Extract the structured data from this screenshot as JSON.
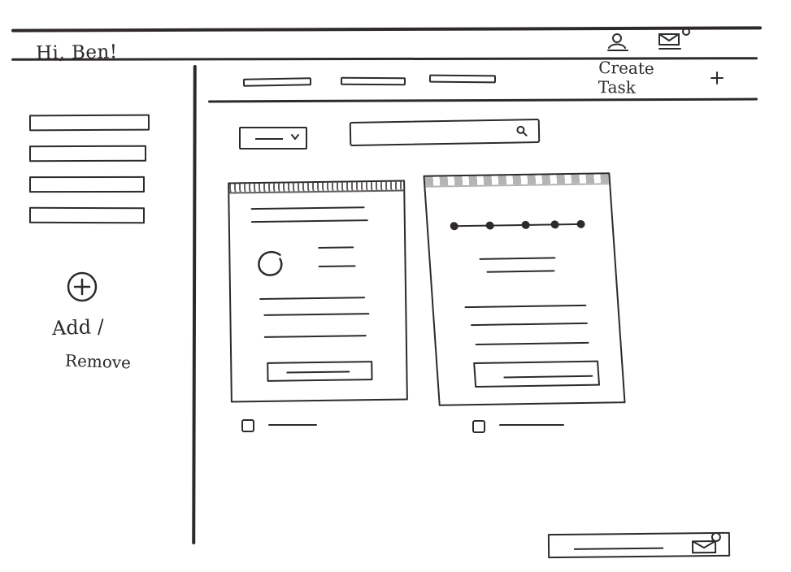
{
  "header": {
    "greeting": "Hi, Ben!",
    "icons": {
      "profile": "user-icon",
      "mail": "mail-icon"
    }
  },
  "top_nav": {
    "tabs": [
      {
        "label": ""
      },
      {
        "label": ""
      },
      {
        "label": ""
      }
    ],
    "create_task": {
      "label": "Create Task",
      "icon": "plus-icon"
    }
  },
  "sidebar": {
    "items": [
      {
        "label": ""
      },
      {
        "label": ""
      },
      {
        "label": ""
      },
      {
        "label": ""
      }
    ],
    "add_remove": {
      "icon": "plus-circle-icon",
      "add_label": "Add /",
      "remove_label": "Remove"
    }
  },
  "filters": {
    "dropdown": {
      "selected": ""
    },
    "search": {
      "value": "",
      "placeholder": "",
      "icon": "search-icon"
    }
  },
  "cards": [
    {
      "checkbox_label": "",
      "button_label": ""
    },
    {
      "checkbox_label": "",
      "button_label": ""
    }
  ],
  "footer_widget": {
    "text": "",
    "icon": "mail-icon"
  },
  "colors": {
    "ink": "#2f2a2a",
    "paper": "#ffffff"
  }
}
